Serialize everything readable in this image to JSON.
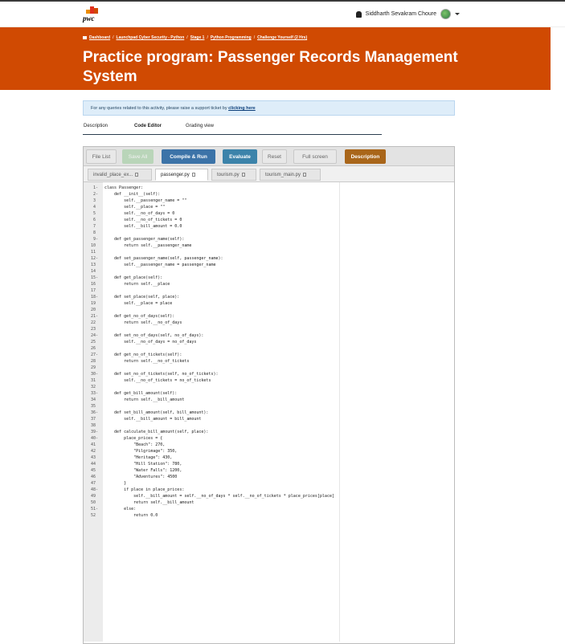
{
  "header": {
    "logo_text": "pwc",
    "user_name": "Siddharth Sevakram Choure"
  },
  "breadcrumbs": [
    "Dashboard",
    "Launchpad Cyber Security - Python",
    "Stage 1",
    "Python Programming",
    "Challenge Yourself (2 Hrs)"
  ],
  "page_title": "Practice program: Passenger Records Management System",
  "notice": {
    "text": "For any queries related to this activity, please raise a support ticket by ",
    "link": "clicking here"
  },
  "tabs": [
    "Description",
    "Code Editor",
    "Grading view"
  ],
  "active_tab": "Code Editor",
  "toolbar": {
    "file_list": "File List",
    "save_all": "Save All",
    "compile_run": "Compile & Run",
    "evaluate": "Evaluate",
    "reset": "Reset",
    "full_screen": "Full screen",
    "description": "Description"
  },
  "file_tabs": [
    "invalid_place_ex...",
    "passenger.py",
    "tourism.py",
    "tourism_main.py"
  ],
  "active_file": "passenger.py",
  "code_lines": [
    "class Passenger:",
    "    def __init__(self):",
    "        self.__passenger_name = \"\"",
    "        self.__place = \"\"",
    "        self.__no_of_days = 0",
    "        self.__no_of_tickets = 0",
    "        self.__bill_amount = 0.0",
    "",
    "    def get_passenger_name(self):",
    "        return self.__passenger_name",
    "",
    "    def set_passenger_name(self, passenger_name):",
    "        self.__passenger_name = passenger_name",
    "",
    "    def get_place(self):",
    "        return self.__place",
    "",
    "    def set_place(self, place):",
    "        self.__place = place",
    "",
    "    def get_no_of_days(self):",
    "        return self.__no_of_days",
    "",
    "    def set_no_of_days(self, no_of_days):",
    "        self.__no_of_days = no_of_days",
    "",
    "    def get_no_of_tickets(self):",
    "        return self.__no_of_tickets",
    "",
    "    def set_no_of_tickets(self, no_of_tickets):",
    "        self.__no_of_tickets = no_of_tickets",
    "",
    "    def get_bill_amount(self):",
    "        return self.__bill_amount",
    "",
    "    def set_bill_amount(self, bill_amount):",
    "        self.__bill_amount = bill_amount",
    "",
    "    def calculate_bill_amount(self, place):",
    "        place_prices = {",
    "            \"Beach\": 270,",
    "            \"Pilgrimage\": 350,",
    "            \"Heritage\": 430,",
    "            \"Hill Station\": 780,",
    "            \"Water Falls\": 1200,",
    "            \"Adventures\": 4500",
    "        }",
    "        if place in place_prices:",
    "            self.__bill_amount = self.__no_of_days * self.__no_of_tickets * place_prices[place]",
    "            return self.__bill_amount",
    "        else:",
    "            return 0.0"
  ],
  "fold_lines": [
    1,
    2,
    9,
    12,
    15,
    18,
    21,
    24,
    27,
    30,
    33,
    36,
    39,
    40,
    48,
    51
  ]
}
